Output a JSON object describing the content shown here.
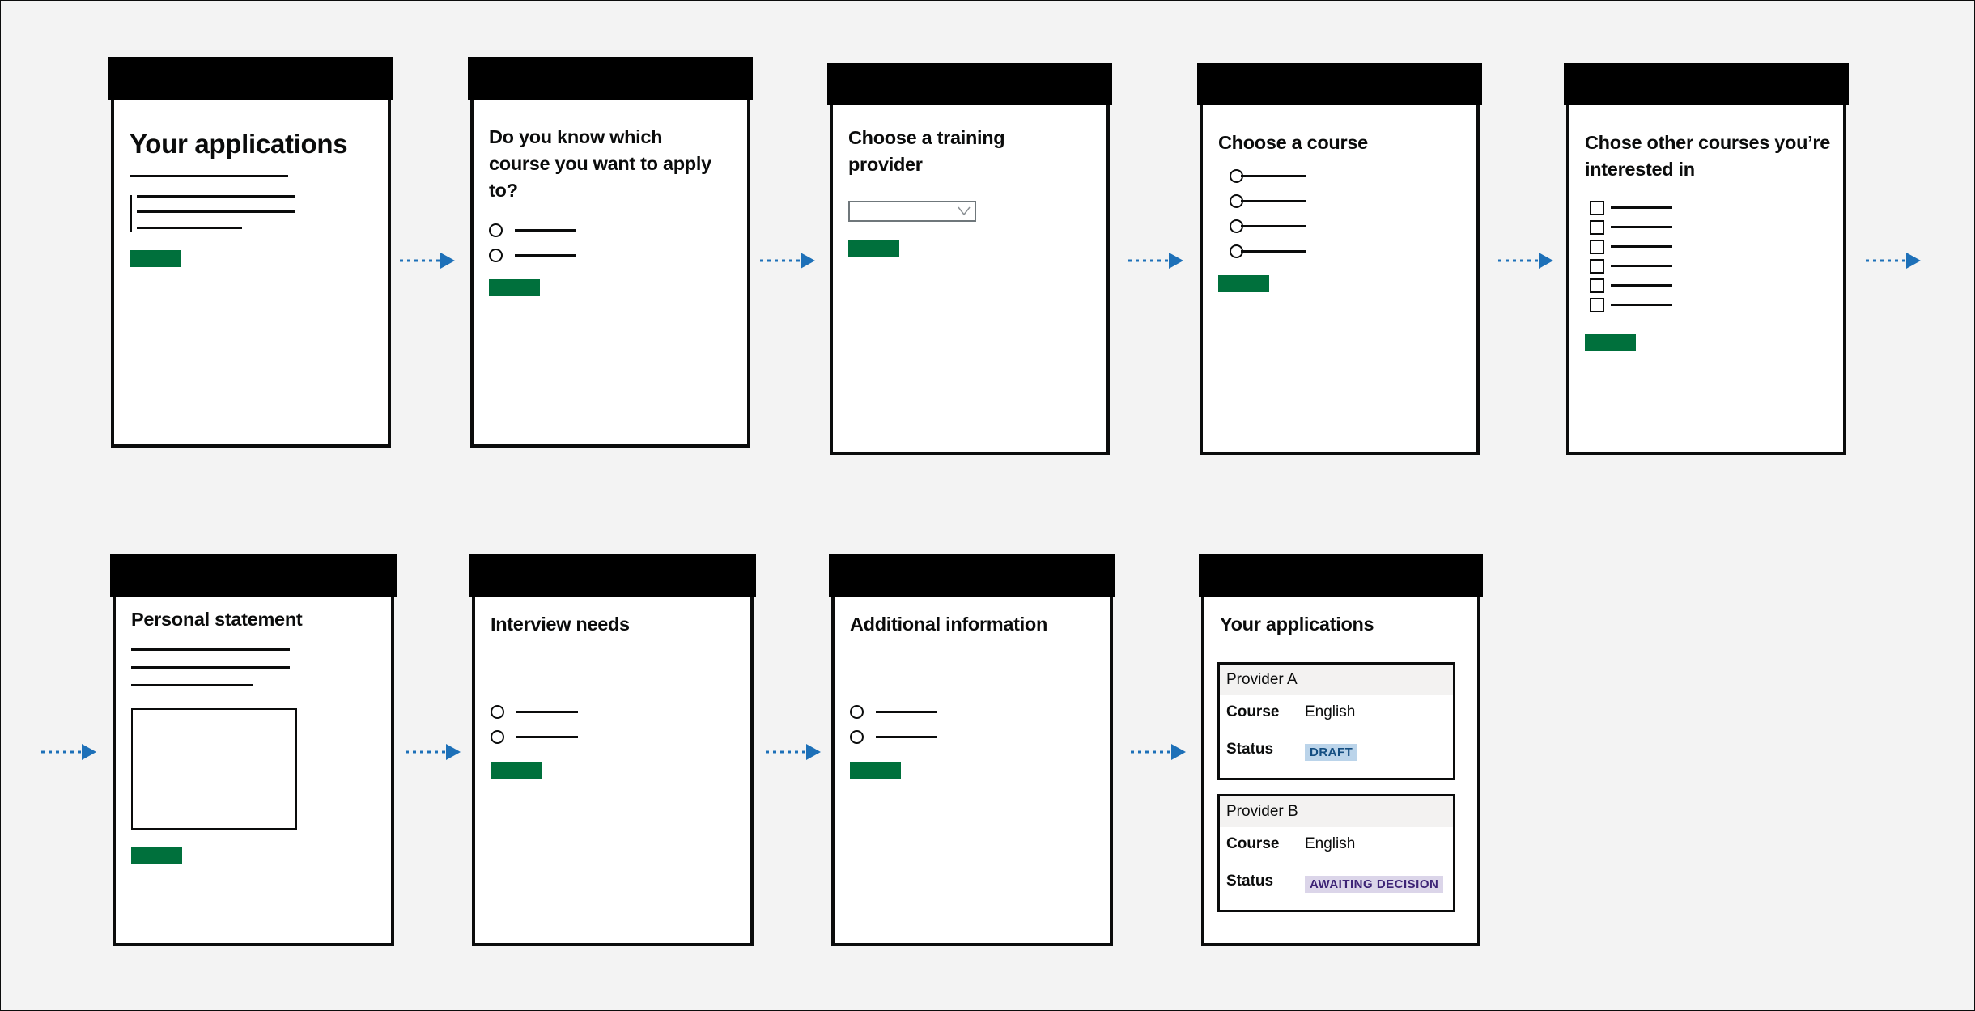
{
  "colors": {
    "background": "#f3f3f3",
    "frame_bar": "#000000",
    "button": "#00703c",
    "arrow": "#1d70b8",
    "tag_draft_bg": "#bbd4ea",
    "tag_draft_text": "#144e81",
    "tag_awaiting_bg": "#dbd5e9",
    "tag_awaiting_text": "#3d2375"
  },
  "row1": {
    "screen1": {
      "title": "Your applications"
    },
    "screen2": {
      "title": "Do you know which course you want to apply to?"
    },
    "screen3": {
      "title": "Choose a training provider"
    },
    "screen4": {
      "title": "Choose a course"
    },
    "screen5": {
      "title": "Chose other courses you’re interested in"
    }
  },
  "row2": {
    "screen6": {
      "title": "Personal statement"
    },
    "screen7": {
      "title": "Interview needs"
    },
    "screen8": {
      "title": "Additional information"
    },
    "screen9": {
      "title": "Your applications",
      "cards": [
        {
          "provider": "Provider A",
          "course_key": "Course",
          "course_value": "English",
          "status_key": "Status",
          "status_value": "DRAFT"
        },
        {
          "provider": "Provider B",
          "course_key": "Course",
          "course_value": "English",
          "status_key": "Status",
          "status_value": "AWAITING DECISION"
        }
      ]
    }
  },
  "icons": {
    "flow_arrow": "arrow-right-dotted-icon",
    "select_chevron": "chevron-down-icon"
  }
}
